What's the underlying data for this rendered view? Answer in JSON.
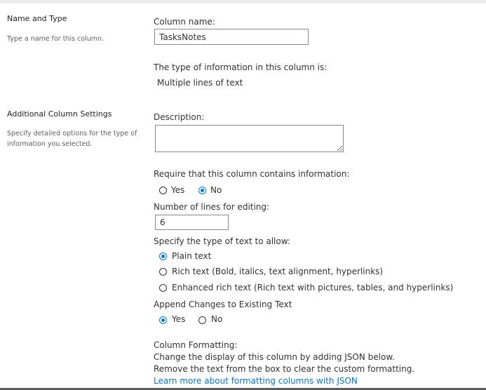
{
  "name_type": {
    "title": "Name and Type",
    "description": "Type a name for this column.",
    "column_name_label": "Column name:",
    "column_name_value": "TasksNotes",
    "type_label": "The type of information in this column is:",
    "type_value": "Multiple lines of text"
  },
  "additional": {
    "title": "Additional Column Settings",
    "description": "Specify detailed options for the type of information you selected.",
    "description_label": "Description:",
    "description_value": "",
    "require_label": "Require that this column contains information:",
    "require_options": [
      {
        "label": "Yes",
        "selected": false
      },
      {
        "label": "No",
        "selected": true
      }
    ],
    "lines_label": "Number of lines for editing:",
    "lines_value": "6",
    "text_type_label": "Specify the type of text to allow:",
    "text_type_options": [
      {
        "label": "Plain text",
        "selected": true
      },
      {
        "label": "Rich text (Bold, italics, text alignment, hyperlinks)",
        "selected": false
      },
      {
        "label": "Enhanced rich text (Rich text with pictures, tables, and hyperlinks)",
        "selected": false
      }
    ],
    "append_label": "Append Changes to Existing Text",
    "append_options": [
      {
        "label": "Yes",
        "selected": true
      },
      {
        "label": "No",
        "selected": false
      }
    ],
    "formatting_title": "Column Formatting:",
    "formatting_line1": "Change the display of this column by adding JSON below.",
    "formatting_line2": "Remove the text from the box to clear the custom formatting.",
    "formatting_link": "Learn more about formatting columns with JSON"
  },
  "colors": {
    "accent": "#0078d4",
    "text": "#323130",
    "muted": "#605e5c",
    "border": "#8a8886"
  }
}
